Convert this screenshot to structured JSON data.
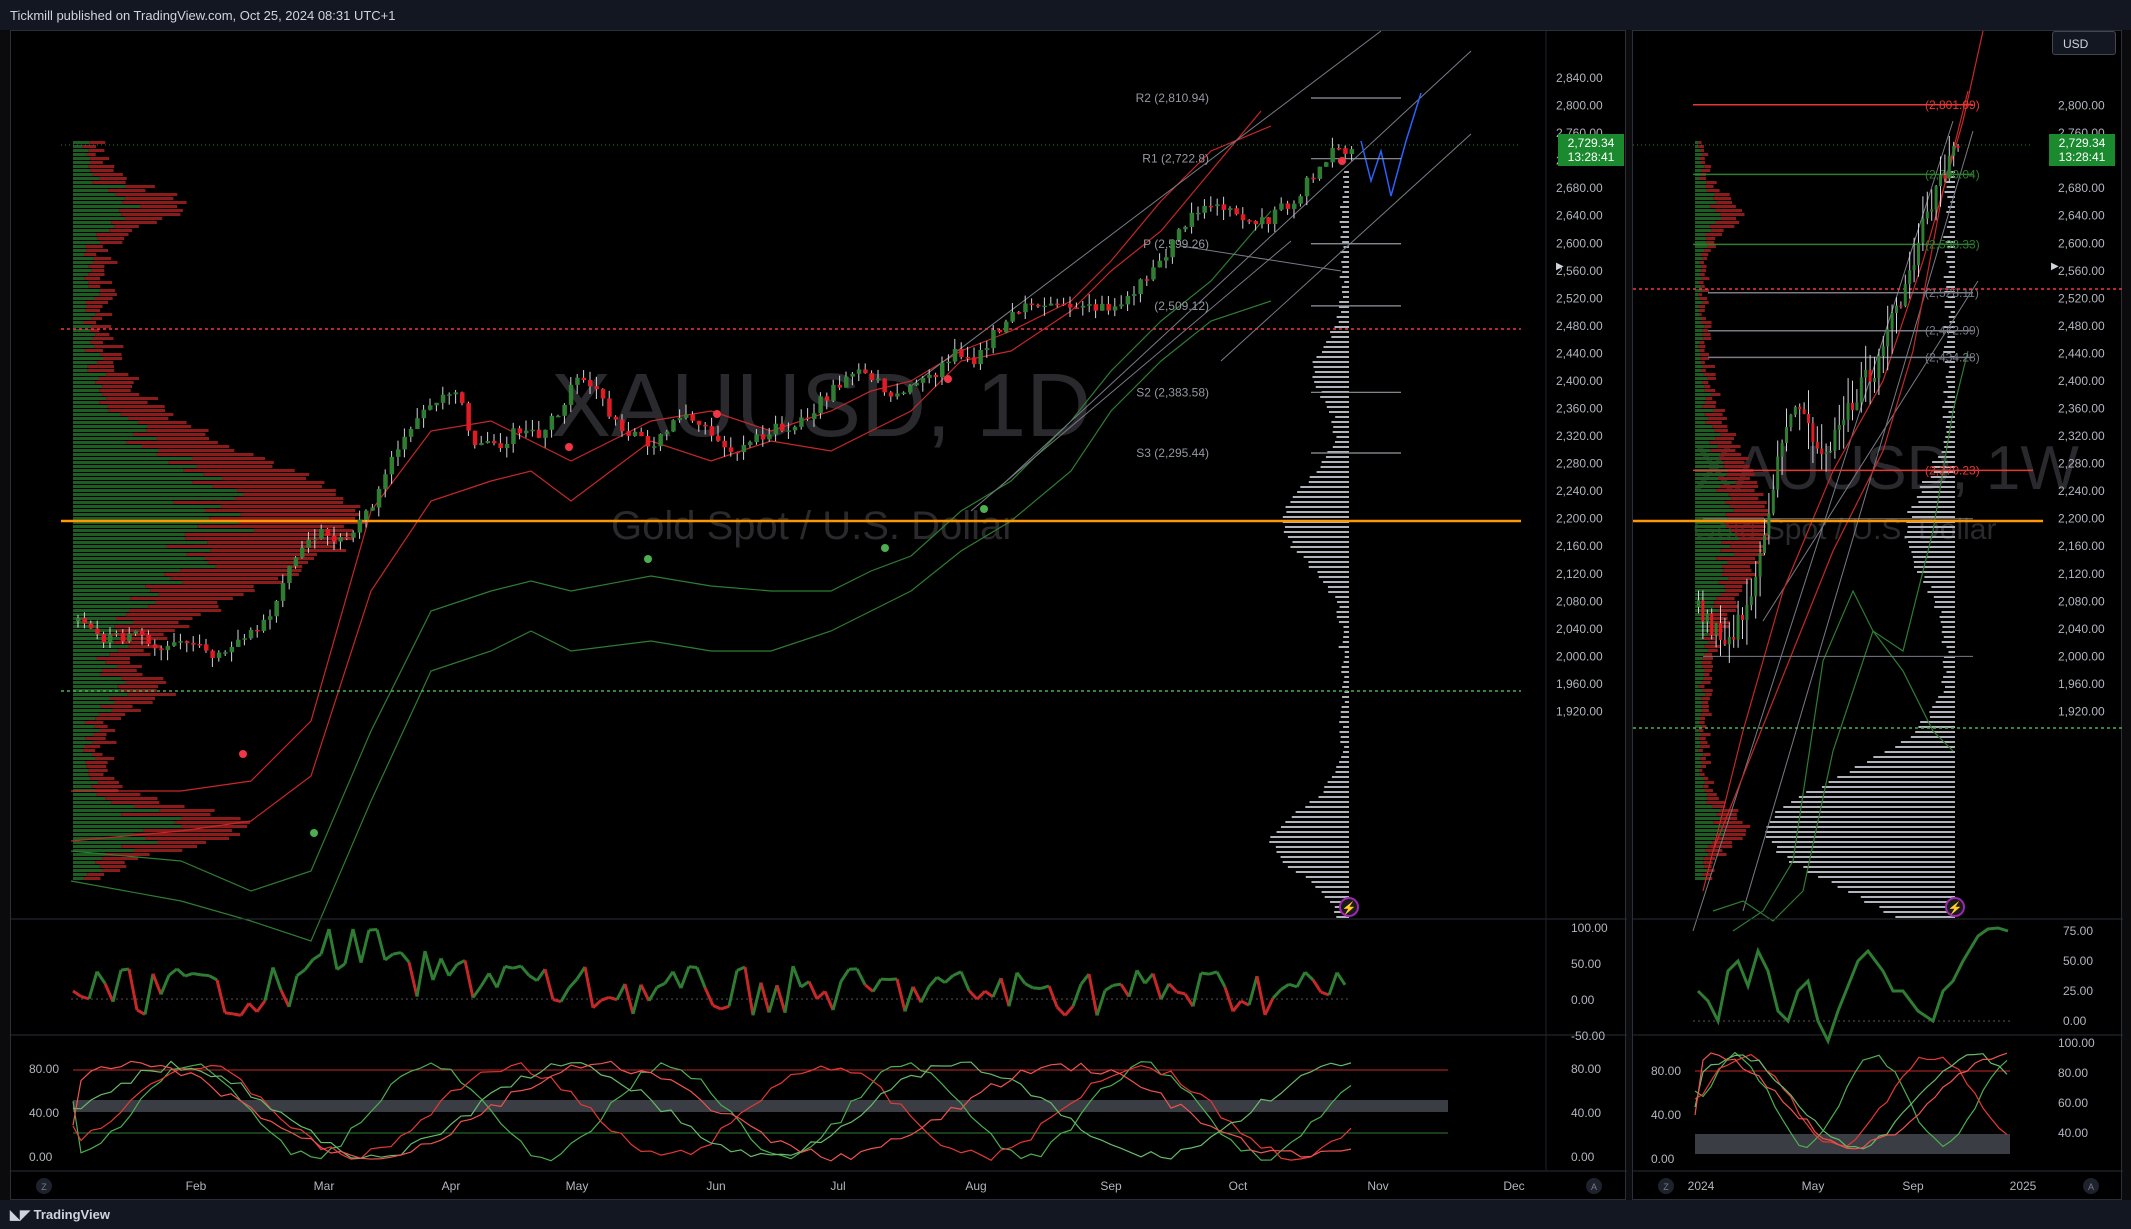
{
  "header": {
    "published": "Tickmill published on TradingView.com, Oct 25, 2024 08:31 UTC+1"
  },
  "footer": {
    "brand": "TradingView"
  },
  "currency": "USD",
  "colors": {
    "up": "#2e7d32",
    "down": "#e01b24",
    "sr_line": "#9598a1",
    "orange": "#ff9800",
    "red_dot": "#f23645",
    "green_dot": "#4caf50"
  },
  "icons": [
    "zoom-z-icon",
    "auto-a-icon",
    "lightning-icon",
    "tradingview-logo-icon"
  ],
  "main": {
    "watermark": "XAUUSD, 1D",
    "watermark_sub": "Gold Spot / U.S. Dollar",
    "price_axis": [
      "2,840.00",
      "2,800.00",
      "2,760.00",
      "2,720.00",
      "2,680.00",
      "2,640.00",
      "2,600.00",
      "2,560.00",
      "2,520.00",
      "2,480.00",
      "2,440.00",
      "2,400.00",
      "2,360.00",
      "2,320.00",
      "2,280.00",
      "2,240.00",
      "2,200.00",
      "2,160.00",
      "2,120.00",
      "2,080.00",
      "2,040.00",
      "2,000.00",
      "1,960.00",
      "1,920.00"
    ],
    "last_price": "2,729.34",
    "countdown": "13:28:41",
    "levels": [
      {
        "label": "R2 (2,810.94)",
        "value": 2810.94
      },
      {
        "label": "R1 (2,722.8)",
        "value": 2722.8
      },
      {
        "label": "P (2,599.26)",
        "value": 2599.26
      },
      {
        "label": "(2,509.12)",
        "value": 2509.12
      },
      {
        "label": "S2 (2,383.58)",
        "value": 2383.58
      },
      {
        "label": "S3 (2,295.44)",
        "value": 2295.44
      }
    ],
    "months": [
      "Feb",
      "Mar",
      "Apr",
      "May",
      "Jun",
      "Jul",
      "Aug",
      "Sep",
      "Oct",
      "Nov",
      "Dec"
    ],
    "rsi_axis": [
      "100.00",
      "50.00",
      "0.00",
      "-50.00"
    ],
    "stoch_axis": [
      "80.00",
      "40.00",
      "0.00"
    ]
  },
  "side": {
    "watermark": "XAUUSD, 1W",
    "watermark_sub": "Gold Spot / U.S. Dollar",
    "price_axis": [
      "2,800.00",
      "2,760.00",
      "2,720.00",
      "2,680.00",
      "2,640.00",
      "2,600.00",
      "2,560.00",
      "2,520.00",
      "2,480.00",
      "2,440.00",
      "2,400.00",
      "2,360.00",
      "2,320.00",
      "2,280.00",
      "2,240.00",
      "2,200.00",
      "2,160.00",
      "2,120.00",
      "2,080.00",
      "2,040.00",
      "2,000.00",
      "1,960.00",
      "1,920.00"
    ],
    "last_price": "2,729.34",
    "countdown": "13:28:41",
    "levels": [
      {
        "label": "(2,801.09)",
        "value": 2801.09
      },
      {
        "label": "(2,700.04)",
        "value": 2700.04
      },
      {
        "label": "(2,598.33)",
        "value": 2598.33
      },
      {
        "label": "(2,528.11)",
        "value": 2528.11
      },
      {
        "label": "(2,472.99)",
        "value": 2472.99
      },
      {
        "label": "(2,434.28)",
        "value": 2434.28
      },
      {
        "label": "(2,270.23)",
        "value": 2270.23
      }
    ],
    "months": [
      "2024",
      "May",
      "Sep",
      "2025"
    ],
    "rsi_axis": [
      "75.00",
      "50.00",
      "25.00",
      "0.00"
    ],
    "stoch_axis_left": [
      "80.00",
      "40.00",
      "0.00"
    ],
    "stoch_axis_right": [
      "100.00",
      "80.00",
      "60.00",
      "40.00"
    ]
  }
}
